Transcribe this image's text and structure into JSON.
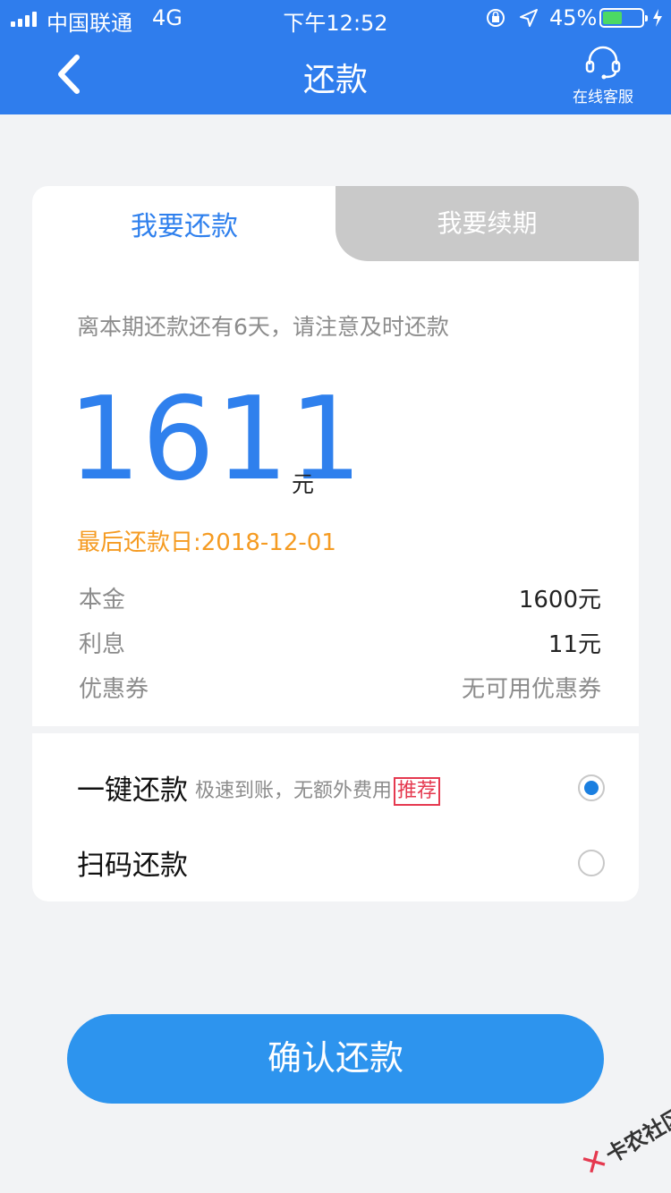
{
  "status_bar": {
    "carrier": "中国联通",
    "network": "4G",
    "time": "下午12:52",
    "battery_percent": "45%",
    "battery_level": 0.45
  },
  "nav": {
    "title": "还款",
    "support_label": "在线客服"
  },
  "tabs": {
    "repay": "我要还款",
    "renew": "我要续期"
  },
  "notice": "离本期还款还有6天，请注意及时还款",
  "amount": {
    "value": "1611",
    "unit": "元"
  },
  "due_date": "最后还款日:2018-12-01",
  "details": [
    {
      "label": "本金",
      "value": "1600元"
    },
    {
      "label": "利息",
      "value": "11元"
    },
    {
      "label": "优惠券",
      "value": "无可用优惠券"
    }
  ],
  "methods": [
    {
      "name": "一键还款",
      "desc": "极速到账，无额外费用",
      "tag": "推荐",
      "selected": true
    },
    {
      "name": "扫码还款",
      "selected": false
    }
  ],
  "confirm_label": "确认还款",
  "watermark": "卡农社区",
  "colors": {
    "primary": "#2f7ded",
    "amount": "#2f80ed",
    "warning": "#f59b22",
    "tag": "#e5394f",
    "button": "#2d94ee"
  }
}
